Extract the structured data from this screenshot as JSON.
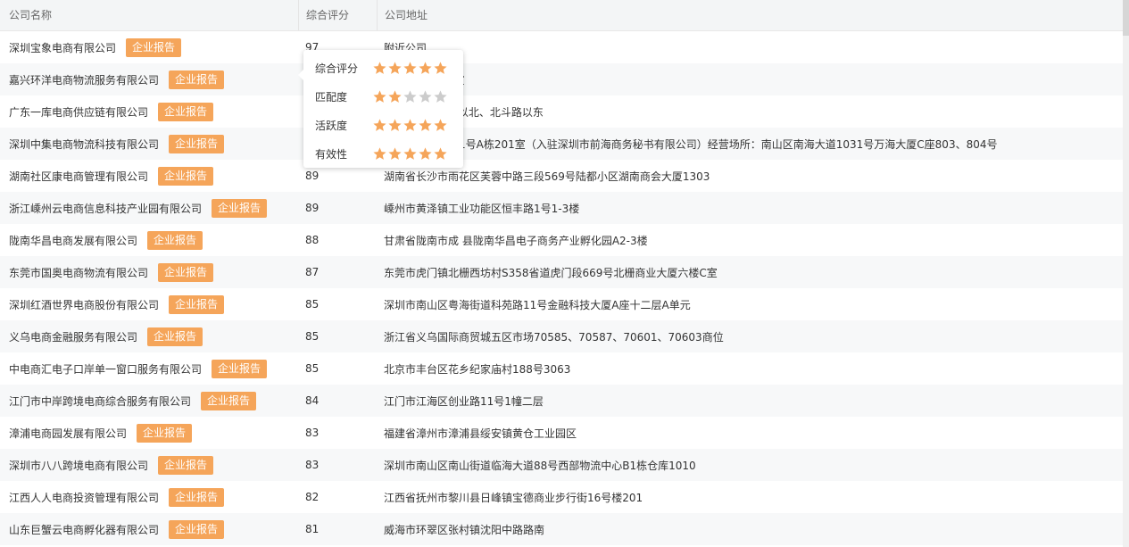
{
  "table": {
    "headers": {
      "name": "公司名称",
      "score": "综合评分",
      "address": "公司地址"
    },
    "report_label": "企业报告",
    "rows": [
      {
        "name": "深圳宝象电商有限公司",
        "score": "97",
        "address": "附近公司"
      },
      {
        "name": "嘉兴环洋电商物流服务有限公司",
        "score": "",
        "address": "公建6商铺201室"
      },
      {
        "name": "广东一库电商供应链有限公司",
        "score": "",
        "address": "业开发区335线以北、北斗路以东"
      },
      {
        "name": "深圳中集电商物流科技有限公司",
        "score": "",
        "address": "合作区前湾一路1号A栋201室（入驻深圳市前海商务秘书有限公司）经营场所：南山区南海大道1031号万海大厦C座803、804号"
      },
      {
        "name": "湖南社区康电商管理有限公司",
        "score": "89",
        "address": "湖南省长沙市雨花区芙蓉中路三段569号陆都小区湖南商会大厦1303"
      },
      {
        "name": "浙江嵊州云电商信息科技产业园有限公司",
        "score": "89",
        "address": "嵊州市黄泽镇工业功能区恒丰路1号1-3楼"
      },
      {
        "name": "陇南华昌电商发展有限公司",
        "score": "88",
        "address": "甘肃省陇南市成 县陇南华昌电子商务产业孵化园A2-3楼"
      },
      {
        "name": "东莞市国奥电商物流有限公司",
        "score": "87",
        "address": "东莞市虎门镇北栅西坊村S358省道虎门段669号北栅商业大厦六楼C室"
      },
      {
        "name": "深圳红酒世界电商股份有限公司",
        "score": "85",
        "address": "深圳市南山区粤海街道科苑路11号金融科技大厦A座十二层A单元"
      },
      {
        "name": "义乌电商金融服务有限公司",
        "score": "85",
        "address": "浙江省义乌国际商贸城五区市场70585、70587、70601、70603商位"
      },
      {
        "name": "中电商汇电子口岸单一窗口服务有限公司",
        "score": "85",
        "address": "北京市丰台区花乡纪家庙村188号3063"
      },
      {
        "name": "江门市中岸跨境电商综合服务有限公司",
        "score": "84",
        "address": "江门市江海区创业路11号1幢二层"
      },
      {
        "name": "漳浦电商园发展有限公司",
        "score": "83",
        "address": "福建省漳州市漳浦县绥安镇黄仓工业园区"
      },
      {
        "name": "深圳市八八跨境电商有限公司",
        "score": "83",
        "address": "深圳市南山区南山街道临海大道88号西部物流中心B1栋仓库1010"
      },
      {
        "name": "江西人人电商投资管理有限公司",
        "score": "82",
        "address": "江西省抚州市黎川县日峰镇宝德商业步行街16号楼201"
      },
      {
        "name": "山东巨蟹云电商孵化器有限公司",
        "score": "81",
        "address": "威海市环翠区张村镇沈阳中路路南"
      }
    ]
  },
  "popover": {
    "metrics": [
      {
        "label": "综合评分",
        "stars": 5
      },
      {
        "label": "匹配度",
        "stars": 2
      },
      {
        "label": "活跃度",
        "stars": 5
      },
      {
        "label": "有效性",
        "stars": 5
      }
    ],
    "max_stars": 5
  },
  "colors": {
    "report_button": "#f5a55a",
    "star_filled": "#f5a55a",
    "star_empty": "#cccccc",
    "header_bg": "#f3f5f6",
    "row_alt_bg": "#f7f8f9"
  },
  "icons": {
    "star": "star-icon"
  }
}
